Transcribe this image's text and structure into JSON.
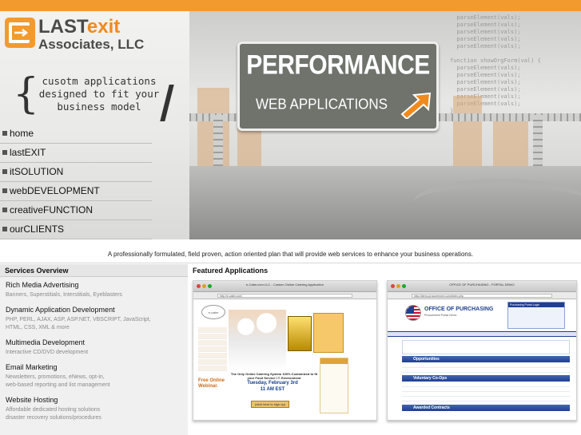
{
  "header": {
    "logo": {
      "line1_a": "LAST",
      "line1_b": "exit",
      "line2": "Associates, LLC"
    },
    "tagline": [
      "cusotm applications",
      "designed to fit your",
      "business model"
    ],
    "nav": [
      {
        "label": "home"
      },
      {
        "label": "lastEXIT"
      },
      {
        "label": "itSOLUTION"
      },
      {
        "label": "webDEVELOPMENT"
      },
      {
        "label": "creativeFUNCTION"
      },
      {
        "label": "ourCLIENTS"
      }
    ],
    "sign": {
      "title": "PERFORMANCE",
      "subtitle": "WEB APPLICATIONS"
    }
  },
  "intro": "A professionally formulated, field proven, action oriented plan that will provide web services to enhance your business operations.",
  "services": {
    "title": "Services Overview",
    "items": [
      {
        "title": "Rich Media Advertising",
        "desc": [
          "Banners, Superstitials, Interstitials, Eyeblasters"
        ]
      },
      {
        "title": "Dynamic Application Development",
        "desc": [
          "PHP, PERL, AJAX, ASP, ASP.NET, VBSCRIPT, JavaScript,",
          "HTML, CSS, XML & more"
        ]
      },
      {
        "title": "Multimedia Development",
        "desc": [
          "Interactive CD/DVD development"
        ]
      },
      {
        "title": "Email Marketing",
        "desc": [
          "Newsletters, promotions, eNews, opt-in,",
          "web-based reporting and list management"
        ]
      },
      {
        "title": "Website Hosting",
        "desc": [
          "Affordable dedicated hosting solutions",
          "disaster recovery solutions/procedures"
        ]
      }
    ]
  },
  "featured": {
    "title": "Featured Applications",
    "shots": [
      {
        "window_title": "e-Cater.com LLC - Custom Online Catering Application",
        "url": "http://e-cater.com/",
        "headline": "The Only Online Catering System 100% Customized to fit your Food Service I.T. Environment",
        "webinar": "Free Online Webinar.",
        "date_lines": [
          "Tuesday, February 3rd",
          "11 AM EST"
        ],
        "button": "(click here to sign up)"
      },
      {
        "window_title": "OFFICE OF PURCHASING - PORTAL DEMO",
        "url": "http://demo.procurement.com/index.php",
        "title": "OFFICE OF PURCHASING",
        "subtitle": "Procurement Portal Demo",
        "login": "Purchasing Portal Login",
        "section1": "Opportunities",
        "section2": "Voluntary Co-Ops",
        "section3": "Awarded Contracts"
      }
    ]
  }
}
